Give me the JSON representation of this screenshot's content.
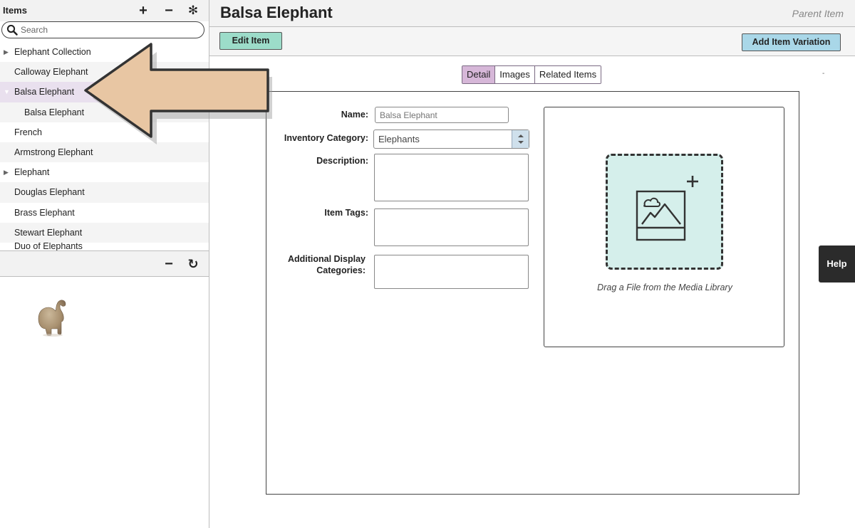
{
  "sidebar": {
    "title": "Items",
    "tools": {
      "add": "+",
      "remove": "−",
      "settings": "✻"
    },
    "search": {
      "placeholder": "Search",
      "value": ""
    },
    "items": [
      {
        "label": "Elephant Collection",
        "toggle": "▶",
        "level": 0,
        "selected": false
      },
      {
        "label": "Calloway Elephant",
        "toggle": "",
        "level": 0,
        "selected": false
      },
      {
        "label": "Balsa Elephant",
        "toggle": "▼",
        "level": 0,
        "selected": true
      },
      {
        "label": "Balsa Elephant",
        "toggle": "",
        "level": 1,
        "selected": false
      },
      {
        "label": "French",
        "toggle": "",
        "level": 0,
        "selected": false
      },
      {
        "label": "Armstrong Elephant",
        "toggle": "",
        "level": 0,
        "selected": false
      },
      {
        "label": "Elephant",
        "toggle": "▶",
        "level": 0,
        "selected": false
      },
      {
        "label": "Douglas Elephant",
        "toggle": "",
        "level": 0,
        "selected": false
      },
      {
        "label": "Brass Elephant",
        "toggle": "",
        "level": 0,
        "selected": false
      },
      {
        "label": "Stewart Elephant",
        "toggle": "",
        "level": 0,
        "selected": false
      },
      {
        "label": "Duo of Elephants",
        "toggle": "",
        "level": 0,
        "selected": false
      }
    ],
    "sub_tools": {
      "collapse": "−",
      "refresh": "↻"
    }
  },
  "main": {
    "title": "Balsa Elephant",
    "parent_label": "Parent Item",
    "edit_button": "Edit Item",
    "variation_button": "Add Item Variation",
    "tabs": [
      {
        "label": "Detail",
        "active": true
      },
      {
        "label": "Images",
        "active": false
      },
      {
        "label": "Related Items",
        "active": false
      }
    ],
    "dash": "-",
    "form": {
      "name_label": "Name:",
      "name_placeholder": "Balsa Elephant",
      "category_label": "Inventory Category:",
      "category_value": "Elephants",
      "description_label": "Description:",
      "tags_label": "Item Tags:",
      "display_categories_label": "Additional Display Categories:"
    },
    "dropzone_caption": "Drag a File from the Media Library"
  },
  "help": "Help",
  "colors": {
    "edit_button": "#9cdcc9",
    "variation_button": "#a9d7e8",
    "active_tab": "#d6b7d8",
    "dropzone_fill": "#d5efeb",
    "arrow_fill": "#e8c6a3",
    "help_bg": "#2b2b2b"
  }
}
